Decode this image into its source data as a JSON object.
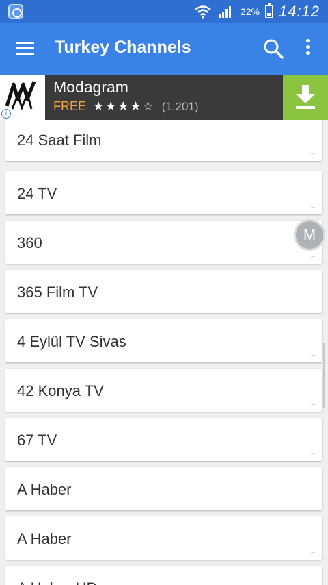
{
  "status_bar": {
    "battery": "22%",
    "time": "14:12",
    "icons": [
      "app-notification-icon",
      "wifi-icon",
      "signal-icon",
      "battery-icon"
    ]
  },
  "toolbar": {
    "title": "Turkey Channels",
    "icons": [
      "menu-icon",
      "search-icon",
      "more-vert-icon"
    ]
  },
  "ad": {
    "app_name": "Modagram",
    "price": "FREE",
    "stars": "★★★★☆",
    "rating_count": "(1.201)",
    "info": "i",
    "colors": {
      "background": "#3a3a3a",
      "price": "#f0a33a",
      "download": "#8bc53f"
    }
  },
  "channels": [
    "24 Saat Film",
    "24 TV",
    "360",
    "365 Film TV",
    "4 Eylül TV Sivas",
    "42 Konya TV",
    "67 TV",
    "A Haber",
    "A Haber",
    "A Haber HD"
  ],
  "floating_button": {
    "label": "M"
  },
  "colors": {
    "status_bar": "#2f6fd1",
    "toolbar": "#3b82e6",
    "list_bg": "#efefef"
  }
}
